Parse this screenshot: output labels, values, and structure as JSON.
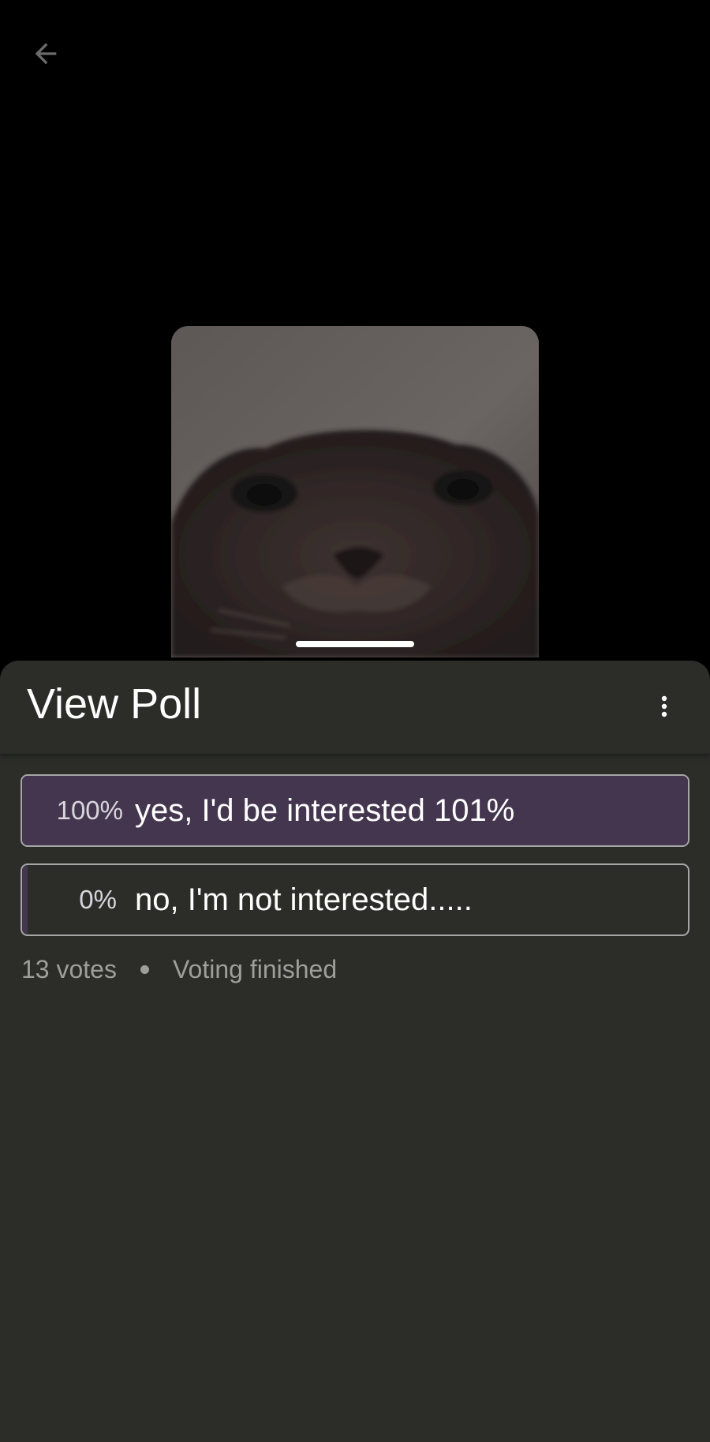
{
  "header": {
    "back_icon": "arrow-left-icon"
  },
  "media": {
    "description_icon": "cat-photo"
  },
  "sheet": {
    "title": "View Poll",
    "more_icon": "more-vertical-icon"
  },
  "poll": {
    "options": [
      {
        "percent_label": "100%",
        "label": "yes, I'd be interested 101%",
        "share": 1.0
      },
      {
        "percent_label": "0%",
        "label": "no, I'm not interested.....",
        "share": 0.0
      }
    ],
    "votes": "13 votes",
    "status": "Voting finished"
  },
  "colors": {
    "sheet_bg": "#2c2d29",
    "fill": "#44364f",
    "border": "#a6a6a6",
    "muted_text": "#9e9e9b"
  }
}
